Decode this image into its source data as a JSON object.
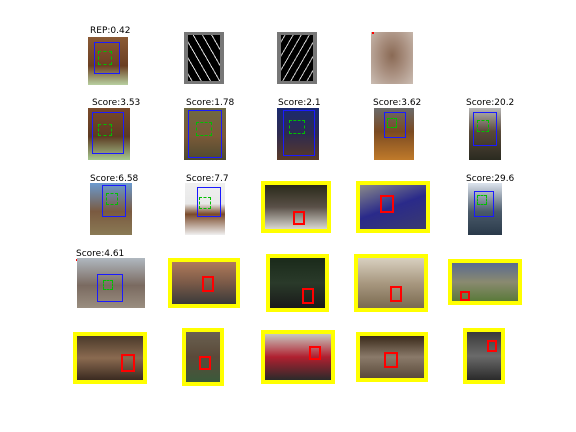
{
  "figure": {
    "rep_label": "REP:0.42",
    "rows": [
      {
        "row": 1,
        "cells": [
          {
            "id": "r1c1",
            "label": "REP:0.42",
            "type": "rep-horse"
          },
          {
            "id": "r1c2",
            "label": "",
            "type": "hog-texture"
          },
          {
            "id": "r1c3",
            "label": "",
            "type": "hog-texture"
          },
          {
            "id": "r1c4",
            "label": "",
            "type": "blurred-horse"
          }
        ]
      },
      {
        "row": 2,
        "cells": [
          {
            "id": "r2c1",
            "label": "Score:3.53"
          },
          {
            "id": "r2c2",
            "label": "Score:1.78"
          },
          {
            "id": "r2c3",
            "label": "Score:2.1"
          },
          {
            "id": "r2c4",
            "label": "Score:3.62"
          },
          {
            "id": "r2c5",
            "label": "Score:20.2"
          }
        ]
      },
      {
        "row": 3,
        "cells": [
          {
            "id": "r3c1",
            "label": "Score:6.58"
          },
          {
            "id": "r3c2",
            "label": "Score:7.7"
          },
          {
            "id": "r3c3",
            "label": "",
            "highlight": "yellow"
          },
          {
            "id": "r3c4",
            "label": "",
            "highlight": "yellow"
          },
          {
            "id": "r3c5",
            "label": "Score:29.6"
          }
        ]
      },
      {
        "row": 4,
        "cells": [
          {
            "id": "r4c1",
            "label": "Score:4.61"
          },
          {
            "id": "r4c2",
            "label": "",
            "highlight": "yellow"
          },
          {
            "id": "r4c3",
            "label": "",
            "highlight": "yellow"
          },
          {
            "id": "r4c4",
            "label": "",
            "highlight": "yellow"
          },
          {
            "id": "r4c5",
            "label": "",
            "highlight": "yellow"
          }
        ]
      },
      {
        "row": 5,
        "cells": [
          {
            "id": "r5c1",
            "label": "",
            "highlight": "yellow"
          },
          {
            "id": "r5c2",
            "label": "",
            "highlight": "yellow"
          },
          {
            "id": "r5c3",
            "label": "",
            "highlight": "yellow"
          },
          {
            "id": "r5c4",
            "label": "",
            "highlight": "yellow"
          },
          {
            "id": "r5c5",
            "label": "",
            "highlight": "yellow"
          }
        ]
      }
    ],
    "labels": {
      "r1c1": "REP:0.42",
      "r2c1": "Score:3.53",
      "r2c2": "Score:1.78",
      "r2c3": "Score:2.1",
      "r2c4": "Score:3.62",
      "r2c5": "Score:20.2",
      "r3c1": "Score:6.58",
      "r3c2": "Score:7.7",
      "r3c5": "Score:29.6",
      "r4c1": "Score:4.61"
    },
    "colors": {
      "highlight": "#ffff00",
      "detection_box": "#1a1aff",
      "part_box": "#00c000",
      "false_positive_box": "#ff0000"
    }
  }
}
